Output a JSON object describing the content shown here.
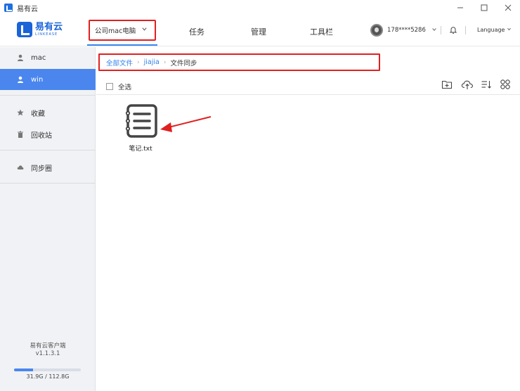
{
  "window": {
    "title": "易有云",
    "controls": [
      "minimize-icon",
      "maximize-icon",
      "close-icon"
    ]
  },
  "header": {
    "brand_name": "易有云",
    "brand_sub": "LINKEASE",
    "device_select": "公司mac电脑",
    "nav": [
      "任务",
      "管理",
      "工具栏"
    ],
    "user_name": "178****5286",
    "language": "Language"
  },
  "sidebar": {
    "devices": [
      {
        "label": "mac",
        "icon": "user-icon"
      },
      {
        "label": "win",
        "icon": "user-icon",
        "active": true
      }
    ],
    "items": [
      {
        "label": "收藏",
        "icon": "star-icon"
      },
      {
        "label": "回收站",
        "icon": "trash-icon"
      },
      {
        "label": "同步圈",
        "icon": "cloud-icon"
      }
    ],
    "footer": {
      "app_name": "易有云客户端",
      "version": "v1.1.3.1",
      "storage_text": "31.9G / 112.8G",
      "storage_fraction": 0.283
    }
  },
  "breadcrumb": {
    "root": "全部文件",
    "middle": "jiajia",
    "current": "文件同步"
  },
  "toolbar": {
    "select_all": "全选",
    "icons": [
      "new-folder-icon",
      "upload-icon",
      "sort-icon",
      "grid-view-icon"
    ]
  },
  "files": [
    {
      "name": "笔记.txt",
      "icon": "notepad-icon"
    }
  ],
  "colors": {
    "accent": "#4a86ee",
    "link": "#2f80ed",
    "highlight_box": "#e02020"
  }
}
